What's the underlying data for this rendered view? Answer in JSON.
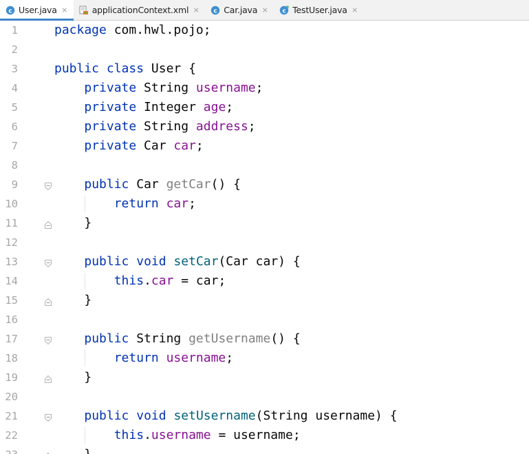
{
  "tabs": [
    {
      "label": "User.java",
      "icon": "java-class-icon",
      "active": true,
      "close": "×"
    },
    {
      "label": "applicationContext.xml",
      "icon": "spring-xml-icon",
      "active": false,
      "close": "×"
    },
    {
      "label": "Car.java",
      "icon": "java-class-icon",
      "active": false,
      "close": "×"
    },
    {
      "label": "TestUser.java",
      "icon": "java-test-class-icon",
      "active": false,
      "close": "×"
    }
  ],
  "colors": {
    "keyword": "#0033b3",
    "field": "#871094",
    "method_declaration": "#00627a",
    "unused_method": "#808080",
    "plain": "#080808",
    "line_number": "#a6a6a6",
    "active_tab_underline": "#4083c9"
  },
  "lines": [
    {
      "n": "1",
      "fold": null,
      "tokens": [
        {
          "t": "package",
          "c": "kw"
        },
        {
          "t": " com.hwl.pojo;",
          "c": "pl"
        }
      ]
    },
    {
      "n": "2",
      "fold": null,
      "tokens": []
    },
    {
      "n": "3",
      "fold": null,
      "tokens": [
        {
          "t": "public",
          "c": "kw"
        },
        {
          "t": " ",
          "c": "pl"
        },
        {
          "t": "class",
          "c": "kw"
        },
        {
          "t": " User {",
          "c": "pl"
        }
      ]
    },
    {
      "n": "4",
      "fold": null,
      "tokens": [
        {
          "t": "    ",
          "c": "pl"
        },
        {
          "t": "private",
          "c": "kw"
        },
        {
          "t": " String ",
          "c": "pl"
        },
        {
          "t": "username",
          "c": "fld"
        },
        {
          "t": ";",
          "c": "pl"
        }
      ]
    },
    {
      "n": "5",
      "fold": null,
      "tokens": [
        {
          "t": "    ",
          "c": "pl"
        },
        {
          "t": "private",
          "c": "kw"
        },
        {
          "t": " Integer ",
          "c": "pl"
        },
        {
          "t": "age",
          "c": "fld"
        },
        {
          "t": ";",
          "c": "pl"
        }
      ]
    },
    {
      "n": "6",
      "fold": null,
      "tokens": [
        {
          "t": "    ",
          "c": "pl"
        },
        {
          "t": "private",
          "c": "kw"
        },
        {
          "t": " String ",
          "c": "pl"
        },
        {
          "t": "address",
          "c": "fld"
        },
        {
          "t": ";",
          "c": "pl"
        }
      ]
    },
    {
      "n": "7",
      "fold": null,
      "tokens": [
        {
          "t": "    ",
          "c": "pl"
        },
        {
          "t": "private",
          "c": "kw"
        },
        {
          "t": " Car ",
          "c": "pl"
        },
        {
          "t": "car",
          "c": "fld"
        },
        {
          "t": ";",
          "c": "pl"
        }
      ]
    },
    {
      "n": "8",
      "fold": null,
      "tokens": []
    },
    {
      "n": "9",
      "fold": "start",
      "tokens": [
        {
          "t": "    ",
          "c": "pl"
        },
        {
          "t": "public",
          "c": "kw"
        },
        {
          "t": " Car ",
          "c": "pl"
        },
        {
          "t": "getCar",
          "c": "mthu"
        },
        {
          "t": "() {",
          "c": "pl"
        }
      ]
    },
    {
      "n": "10",
      "fold": null,
      "tokens": [
        {
          "t": "        ",
          "c": "pl"
        },
        {
          "t": "return",
          "c": "kw"
        },
        {
          "t": " ",
          "c": "pl"
        },
        {
          "t": "car",
          "c": "fld"
        },
        {
          "t": ";",
          "c": "pl"
        }
      ]
    },
    {
      "n": "11",
      "fold": "end",
      "tokens": [
        {
          "t": "    }",
          "c": "pl"
        }
      ]
    },
    {
      "n": "12",
      "fold": null,
      "tokens": []
    },
    {
      "n": "13",
      "fold": "start",
      "tokens": [
        {
          "t": "    ",
          "c": "pl"
        },
        {
          "t": "public",
          "c": "kw"
        },
        {
          "t": " ",
          "c": "pl"
        },
        {
          "t": "void",
          "c": "kw"
        },
        {
          "t": " ",
          "c": "pl"
        },
        {
          "t": "setCar",
          "c": "mth"
        },
        {
          "t": "(Car car) {",
          "c": "pl"
        }
      ]
    },
    {
      "n": "14",
      "fold": null,
      "tokens": [
        {
          "t": "        ",
          "c": "pl"
        },
        {
          "t": "this",
          "c": "kw"
        },
        {
          "t": ".",
          "c": "pl"
        },
        {
          "t": "car",
          "c": "fld"
        },
        {
          "t": " = car;",
          "c": "pl"
        }
      ]
    },
    {
      "n": "15",
      "fold": "end",
      "tokens": [
        {
          "t": "    }",
          "c": "pl"
        }
      ]
    },
    {
      "n": "16",
      "fold": null,
      "tokens": []
    },
    {
      "n": "17",
      "fold": "start",
      "tokens": [
        {
          "t": "    ",
          "c": "pl"
        },
        {
          "t": "public",
          "c": "kw"
        },
        {
          "t": " String ",
          "c": "pl"
        },
        {
          "t": "getUsername",
          "c": "mthu"
        },
        {
          "t": "() {",
          "c": "pl"
        }
      ]
    },
    {
      "n": "18",
      "fold": null,
      "tokens": [
        {
          "t": "        ",
          "c": "pl"
        },
        {
          "t": "return",
          "c": "kw"
        },
        {
          "t": " ",
          "c": "pl"
        },
        {
          "t": "username",
          "c": "fld"
        },
        {
          "t": ";",
          "c": "pl"
        }
      ]
    },
    {
      "n": "19",
      "fold": "end",
      "tokens": [
        {
          "t": "    }",
          "c": "pl"
        }
      ]
    },
    {
      "n": "20",
      "fold": null,
      "tokens": []
    },
    {
      "n": "21",
      "fold": "start",
      "tokens": [
        {
          "t": "    ",
          "c": "pl"
        },
        {
          "t": "public",
          "c": "kw"
        },
        {
          "t": " ",
          "c": "pl"
        },
        {
          "t": "void",
          "c": "kw"
        },
        {
          "t": " ",
          "c": "pl"
        },
        {
          "t": "setUsername",
          "c": "mth"
        },
        {
          "t": "(String username) {",
          "c": "pl"
        }
      ]
    },
    {
      "n": "22",
      "fold": null,
      "tokens": [
        {
          "t": "        ",
          "c": "pl"
        },
        {
          "t": "this",
          "c": "kw"
        },
        {
          "t": ".",
          "c": "pl"
        },
        {
          "t": "username",
          "c": "fld"
        },
        {
          "t": " = username;",
          "c": "pl"
        }
      ]
    },
    {
      "n": "23",
      "fold": "end",
      "tokens": [
        {
          "t": "    }",
          "c": "pl"
        }
      ]
    }
  ]
}
